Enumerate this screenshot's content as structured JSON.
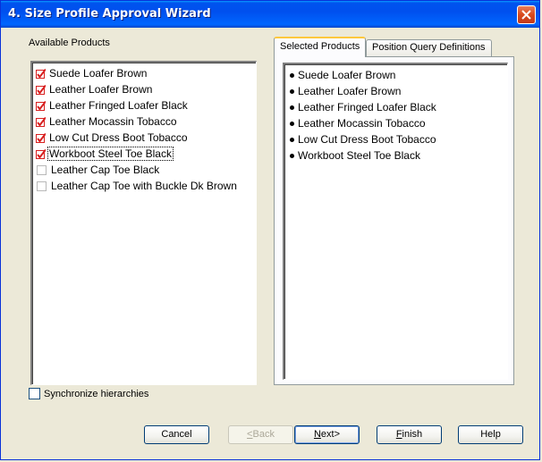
{
  "window": {
    "title": "4. Size Profile Approval Wizard"
  },
  "available": {
    "label": "Available Products",
    "items": [
      {
        "label": "Suede Loafer Brown",
        "checked": true
      },
      {
        "label": "Leather Loafer Brown",
        "checked": true
      },
      {
        "label": "Leather Fringed Loafer Black",
        "checked": true
      },
      {
        "label": "Leather Mocassin Tobacco",
        "checked": true
      },
      {
        "label": "Low Cut Dress Boot Tobacco",
        "checked": true
      },
      {
        "label": "Workboot Steel Toe Black",
        "checked": true,
        "focused": true
      },
      {
        "label": "Leather Cap Toe Black",
        "checked": false
      },
      {
        "label": "Leather Cap Toe with Buckle Dk Brown",
        "checked": false
      }
    ]
  },
  "sync": {
    "label": "Synchronize hierarchies",
    "checked": false
  },
  "tabs": [
    {
      "label": "Selected Products",
      "active": true
    },
    {
      "label": "Position Query Definitions",
      "active": false
    }
  ],
  "selected": {
    "items": [
      "Suede Loafer Brown",
      "Leather Loafer Brown",
      "Leather Fringed Loafer Black",
      "Leather Mocassin Tobacco",
      "Low Cut Dress Boot Tobacco",
      "Workboot Steel Toe Black"
    ]
  },
  "buttons": {
    "cancel": "Cancel",
    "back_mnemonic": "<",
    "back_rest": "Back",
    "next_mnemonic": "N",
    "next_rest": "ext>",
    "finish_mnemonic": "F",
    "finish_rest": "inish",
    "help": "Help"
  },
  "colors": {
    "check": "#d81f1f",
    "title_bar": "#0058ee"
  }
}
